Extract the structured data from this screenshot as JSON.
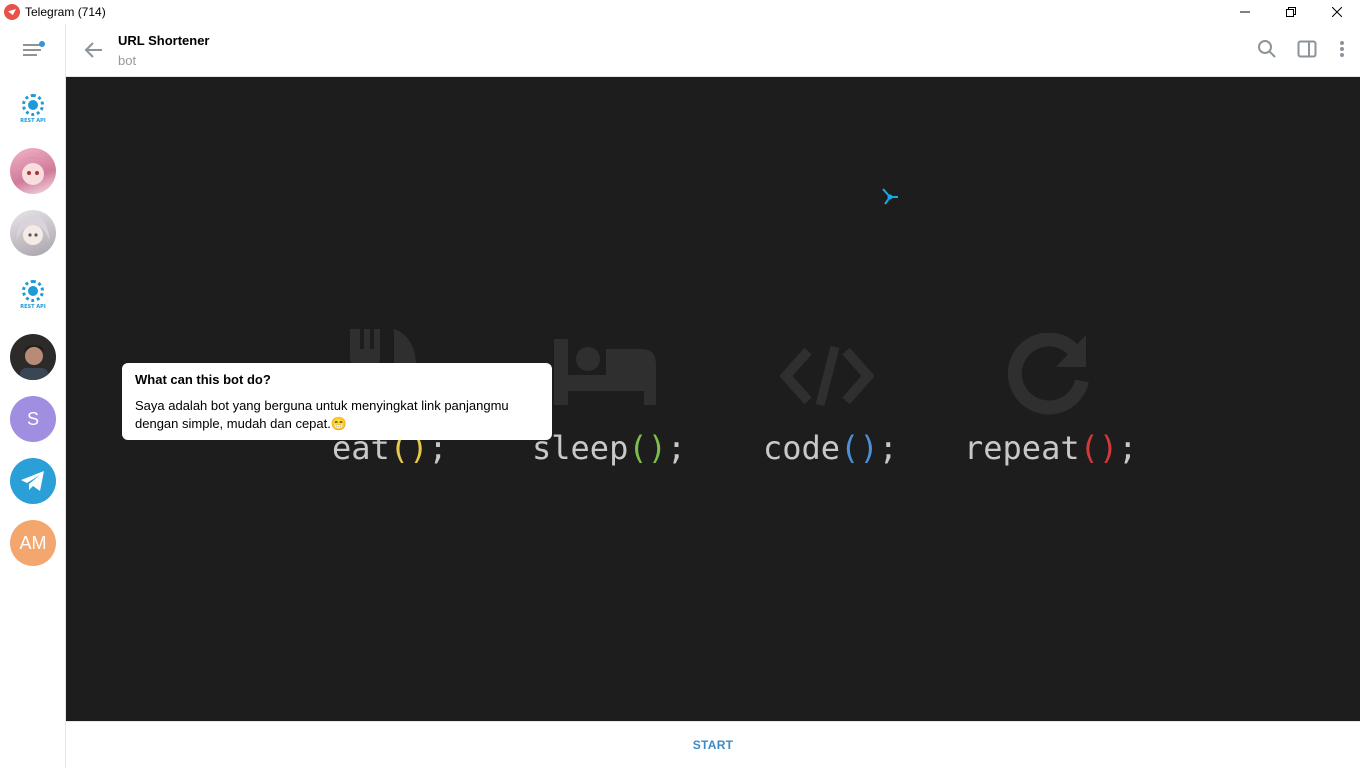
{
  "window": {
    "title": "Telegram (714)",
    "minimize": "—",
    "maximize": "❐",
    "close": "✕"
  },
  "sidebar": {
    "chats": [
      {
        "type": "restapi",
        "label": "REST API"
      },
      {
        "type": "avatar",
        "color": "#d98aa8"
      },
      {
        "type": "avatar",
        "color": "#b7b2b8"
      },
      {
        "type": "restapi",
        "label": "REST API"
      },
      {
        "type": "avatar",
        "color": "#2d2a2a"
      },
      {
        "type": "initials",
        "initials": "S",
        "color": "#a08ee0"
      },
      {
        "type": "telegram",
        "color": "#2a9fd8"
      },
      {
        "type": "initials",
        "initials": "AM",
        "color": "#f4a66f"
      }
    ]
  },
  "header": {
    "title": "URL Shortener",
    "subtitle": "bot"
  },
  "background": {
    "mottos": [
      {
        "word": "eat",
        "parens": "()",
        "semi": ";",
        "paren_color": "#e6c84a"
      },
      {
        "word": "sleep",
        "parens": "()",
        "semi": ";",
        "paren_color": "#7bbf4a"
      },
      {
        "word": "code",
        "parens": "()",
        "semi": ";",
        "paren_color": "#4a8fd8"
      },
      {
        "word": "repeat",
        "parens": "()",
        "semi": ";",
        "paren_color": "#d23a3a"
      }
    ]
  },
  "bot_info": {
    "title": "What can this bot do?",
    "line1": "Saya adalah bot yang berguna untuk menyingkat link panjangmu",
    "line2": "dengan simple, mudah dan cepat.",
    "emoji": "😁"
  },
  "footer": {
    "start_label": "START"
  }
}
